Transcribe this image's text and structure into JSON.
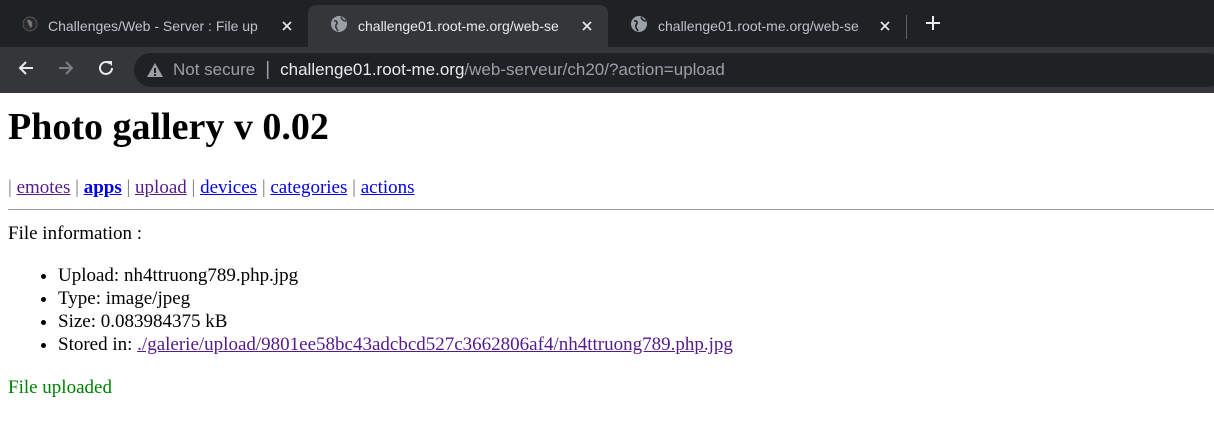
{
  "browser": {
    "tabs": [
      {
        "title": "Challenges/Web - Server : File up",
        "icon": "rootme-favicon-icon",
        "active": false
      },
      {
        "title": "challenge01.root-me.org/web-se",
        "icon": "globe-icon",
        "active": true
      },
      {
        "title": "challenge01.root-me.org/web-se",
        "icon": "globe-icon",
        "active": false
      }
    ],
    "address": {
      "security_label": "Not secure",
      "separator": "|",
      "host": "challenge01.root-me.org",
      "path": "/web-serveur/ch20/?action=upload"
    }
  },
  "page": {
    "title": "Photo gallery v 0.02",
    "nav": {
      "separator": "|",
      "items": [
        "emotes",
        "apps",
        "upload",
        "devices",
        "categories",
        "actions"
      ]
    },
    "file_info_label": "File information :",
    "info": {
      "upload": "Upload: nh4ttruong789.php.jpg",
      "type": "Type: image/jpeg",
      "size": "Size: 0.083984375 kB",
      "stored_label": "Stored in:",
      "stored_link": "./galerie/upload/9801ee58bc43adcbcd527c3662806af4/nh4ttruong789.php.jpg"
    },
    "status": "File uploaded"
  },
  "colors": {
    "link": "#0000ee",
    "visited_link": "#551a8b",
    "success": "#008000",
    "chrome_dark": "#202124",
    "chrome_toolbar": "#35363a"
  }
}
